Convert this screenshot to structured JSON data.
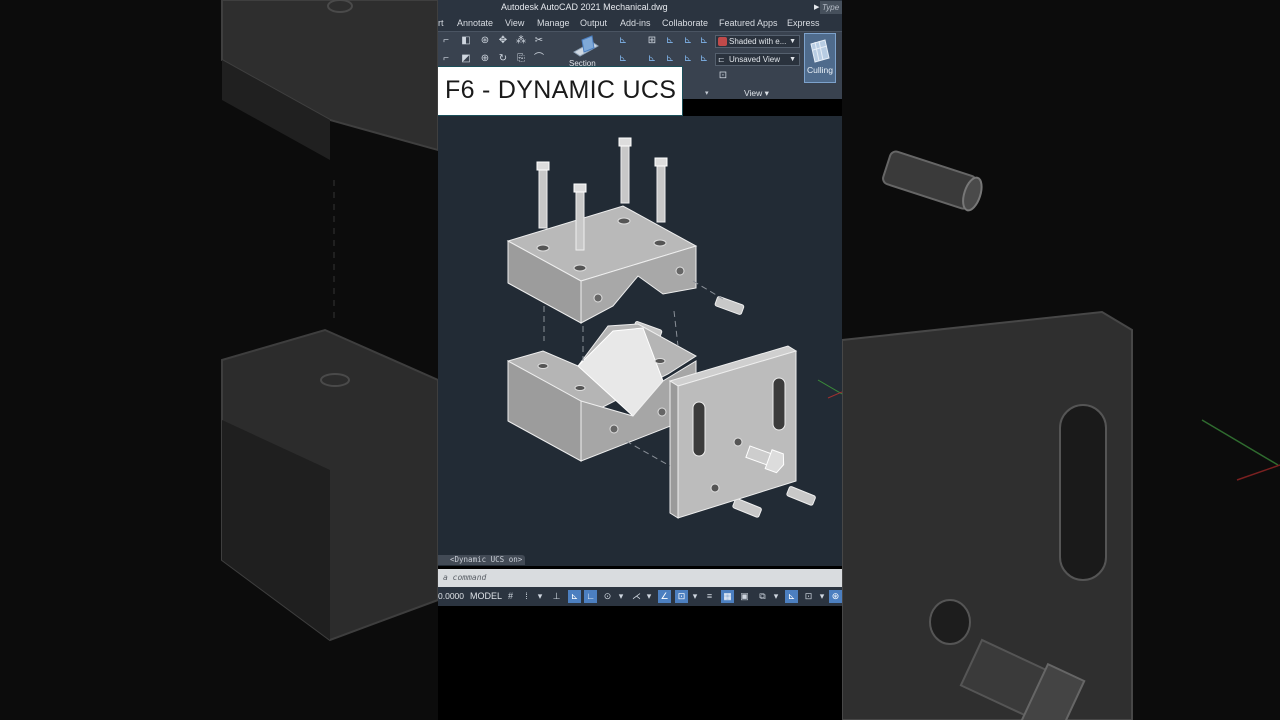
{
  "window": {
    "title": "Autodesk AutoCAD 2021    Mechanical.dwg",
    "search_placeholder": "Type"
  },
  "ribbon_tabs": [
    "rt",
    "Annotate",
    "View",
    "Manage",
    "Output",
    "Add-ins",
    "Collaborate",
    "Featured Apps",
    "Express Tools"
  ],
  "ribbon": {
    "section_label": "Section",
    "visual_style": "Shaded with e...",
    "named_view": "Unsaved View",
    "culling_label": "Culling",
    "view_panel_label": "View ▾"
  },
  "callout": {
    "text": "F6 - DYNAMIC UCS"
  },
  "viewport": {
    "status_message": "<Dynamic UCS on>"
  },
  "command_line": {
    "placeholder": "a command"
  },
  "status_bar": {
    "coords": "0.0000",
    "model_label": "MODEL"
  },
  "colors": {
    "viewport_bg": "#222b35",
    "ribbon_bg": "#39424f",
    "titlebar_bg": "#2b3440",
    "toggle_on": "#4c7fc0"
  }
}
